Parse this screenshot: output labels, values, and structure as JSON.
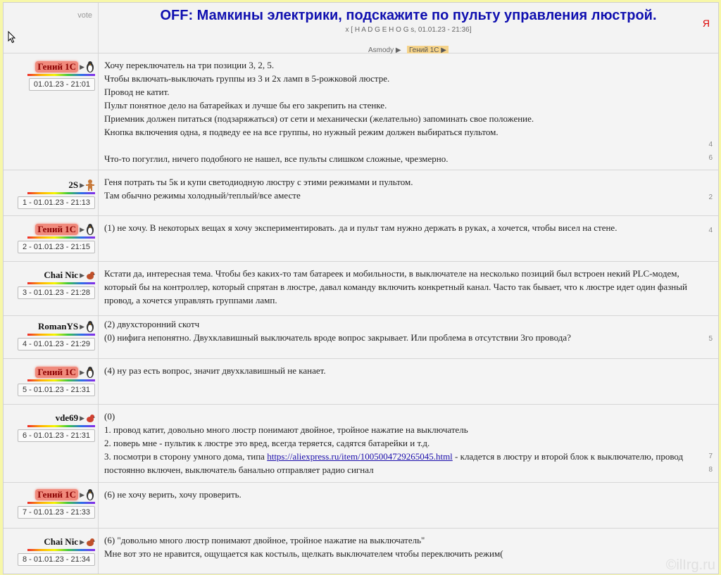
{
  "header": {
    "vote_label": "vote",
    "title": "OFF: Мамкины электрики, подскажите по пульту управления люстрой.",
    "subtitle": "x [ H A D G E H O G s, 01.01.23 - 21:36]",
    "trail": [
      "Asmody ▶",
      "Гений 1С ▶"
    ],
    "yandex": "Я"
  },
  "posts": [
    {
      "user": "Гений 1С",
      "hot": true,
      "stamp": "01.01.23 - 21:01",
      "lines": [
        "Хочу переключатель на три позиции 3, 2, 5.",
        "Чтобы включать-выключать группы из 3 и 2х ламп в 5-рожковой люстре.",
        "Провод не катит.",
        "Пульт понятное дело на батарейках и лучше бы его закрепить на стенке.",
        "Приемник должен питаться (подзаряжаться) от сети и механически (желательно) запоминать свое положение.",
        "Кнопка включения одна, я подведу ее на все группы, но нужный режим должен выбираться пультом.",
        "",
        "Что-то погуглил, ничего подобного не нашел, все пульты слишком сложные, чрезмерно."
      ],
      "replies": [
        "4",
        "6"
      ]
    },
    {
      "user": "2S",
      "hot": false,
      "stamp": "1 - 01.01.23 - 21:13",
      "lines": [
        "Геня потрать ты 5к и купи светодиодную люстру с этими режимами и пультом.",
        "Там обычно режимы холодный/теплый/все аместе"
      ],
      "replies": [
        "2"
      ]
    },
    {
      "user": "Гений 1С",
      "hot": true,
      "stamp": "2 - 01.01.23 - 21:15",
      "lines": [
        "(1) не хочу. В некоторых вещах я хочу экспериментировать. да и пульт там нужно держать в руках, а хочется, чтобы висел на стене."
      ],
      "replies": [
        "4"
      ]
    },
    {
      "user": "Chai Nic",
      "hot": false,
      "stamp": "3 - 01.01.23 - 21:28",
      "lines": [
        "Кстати да, интересная тема. Чтобы без каких-то там батареек и мобильности, в выключателе на несколько позиций был встроен некий PLC-модем,",
        "который бы на контроллер, который спрятан в люстре, давал команду включить конкретный канал. Часто так бывает, что к люстре идет один фазный",
        "провод, а хочется управлять группами ламп."
      ],
      "replies": []
    },
    {
      "user": "RomanYS",
      "hot": false,
      "stamp": "4 - 01.01.23 - 21:29",
      "lines": [
        "(2) двухсторонний скотч",
        "(0) нифига непонятно. Двухклавишный выключатель вроде вопрос закрывает. Или проблема в отсутствии 3го провода?"
      ],
      "replies": [
        "5"
      ]
    },
    {
      "user": "Гений 1С",
      "hot": true,
      "stamp": "5 - 01.01.23 - 21:31",
      "lines": [
        "(4) ну раз есть вопрос, значит двухклавишный не канает."
      ],
      "replies": []
    },
    {
      "user": "vde69",
      "hot": false,
      "stamp": "6 - 01.01.23 - 21:31",
      "lines": [
        "(0)",
        "1. провод катит, довольно много люстр понимают двойное, тройное нажатие на выключатель",
        "2. поверь мне - пультик к люстре это вред, всегда теряется, садятся батарейки и т.д."
      ],
      "line3_pre": "3. посмотри в сторону умного дома, типа ",
      "link": "https://aliexpress.ru/item/1005004729265045.html",
      "line3_post": " - кладется в люстру и второй блок к выключателю, провод",
      "line4": "постоянно включен, выключатель банально отправляет радио сигнал",
      "replies": [
        "7",
        "8"
      ]
    },
    {
      "user": "Гений 1С",
      "hot": true,
      "stamp": "7 - 01.01.23 - 21:33",
      "lines": [
        "(6) не хочу верить, хочу проверить."
      ],
      "replies": []
    },
    {
      "user": "Chai Nic",
      "hot": false,
      "stamp": "8 - 01.01.23 - 21:34",
      "lines": [
        "(6) \"довольно много люстр понимают двойное, тройное нажатие на выключатель\"",
        "Мне вот это не нравится, ощущается как костыль, щелкать выключателем чтобы переключить режим("
      ],
      "replies": []
    }
  ],
  "watermark": "©ilIrg.ru"
}
